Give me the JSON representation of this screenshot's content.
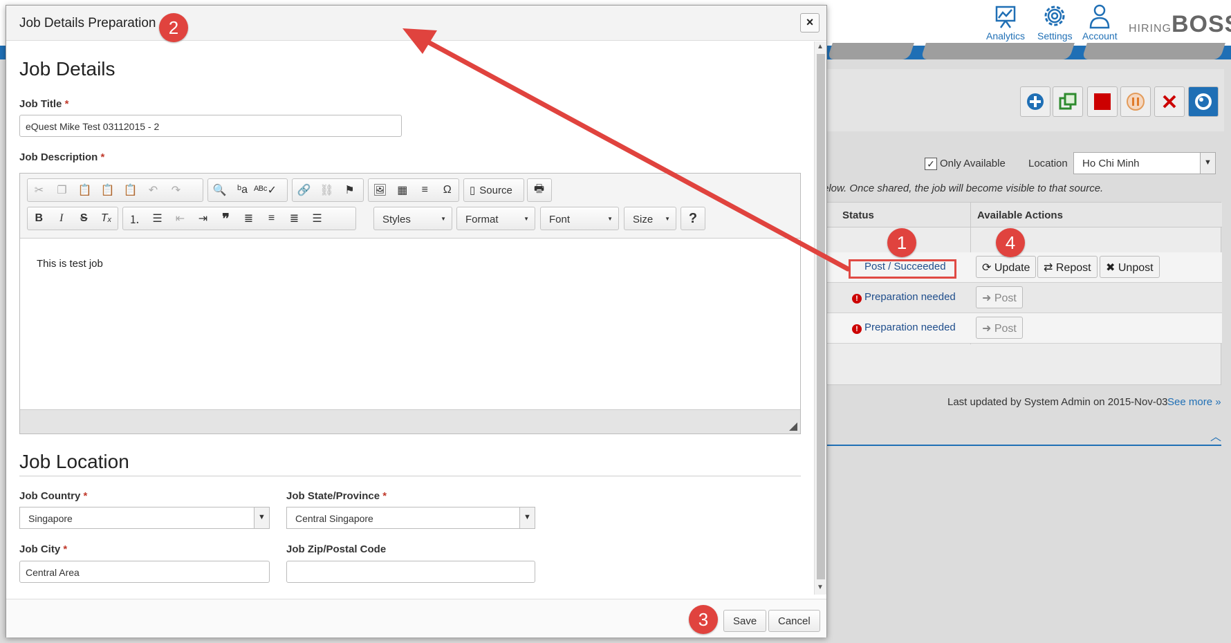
{
  "background": {
    "nav": [
      {
        "label": "Analytics",
        "icon": "analytics-icon"
      },
      {
        "label": "Settings",
        "icon": "gear-icon"
      },
      {
        "label": "Account",
        "icon": "user-icon"
      }
    ],
    "logo_small": "HIRING",
    "logo_big": "BOSS",
    "only_available_label": "Only Available",
    "location_label": "Location",
    "location_value": "Ho Chi Minh",
    "hint_text": "elow. Once shared, the job will become visible to that source.",
    "table": {
      "headers": [
        "Status",
        "Available Actions"
      ],
      "rows": [
        {
          "status": "Post / Succeeded",
          "actions": [
            "Update",
            "Repost",
            "Unpost"
          ]
        },
        {
          "status": "Preparation needed",
          "actions": [
            "Post"
          ]
        },
        {
          "status": "Preparation needed",
          "actions": [
            "Post"
          ]
        }
      ]
    },
    "last_updated": "Last updated by System Admin on 2015-Nov-03",
    "see_more": "See more »"
  },
  "modal": {
    "title": "Job Details Preparation",
    "close_label": "×",
    "section_job_details": "Job Details",
    "job_title_label": "Job Title",
    "job_title_value": "eQuest Mike Test 03112015 - 2",
    "job_description_label": "Job Description",
    "required_mark": "*",
    "editor": {
      "source_label": "Source",
      "dropdowns": [
        "Styles",
        "Format",
        "Font",
        "Size"
      ],
      "help_label": "?",
      "content": "This is test job"
    },
    "section_job_location": "Job Location",
    "country_label": "Job Country",
    "country_value": "Singapore",
    "state_label": "Job State/Province",
    "state_value": "Central Singapore",
    "city_label": "Job City",
    "city_value": "Central Area",
    "zip_label": "Job Zip/Postal Code",
    "zip_value": "",
    "save_label": "Save",
    "cancel_label": "Cancel"
  },
  "annotations": {
    "badge1": "1",
    "badge2": "2",
    "badge3": "3",
    "badge4": "4",
    "color": "#e0433e"
  }
}
